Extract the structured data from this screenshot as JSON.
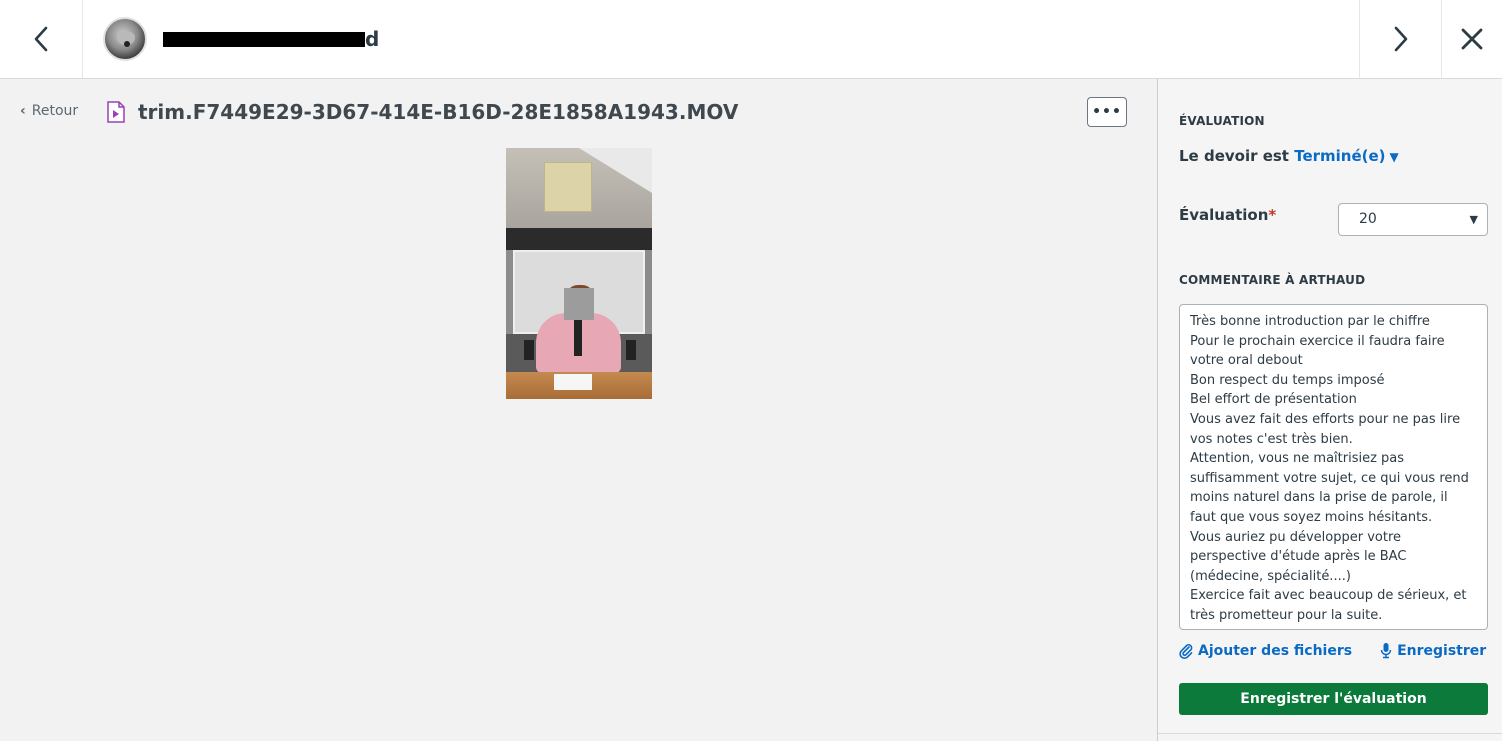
{
  "header": {
    "student_name_tail": "d"
  },
  "main": {
    "back_label": "Retour",
    "file_name": "trim.F7449E29-3D67-414E-B16D-28E1858A1943.MOV",
    "more_label": "•••"
  },
  "sidebar": {
    "section_evaluation": "ÉVALUATION",
    "status_prefix": "Le devoir est ",
    "status_value": "Terminé(e)",
    "grade_label": "Évaluation",
    "grade_required": "*",
    "grade_value": "20",
    "comment_section": "COMMENTAIRE À ARTHAUD",
    "comment_text": "Très bonne introduction par le chiffre\nPour le prochain exercice il faudra faire votre oral debout\nBon respect du temps imposé\nBel effort de présentation\nVous avez fait des efforts pour ne pas lire vos notes c'est très bien.\nAttention, vous ne maîtrisiez pas suffisamment votre sujet, ce qui vous rend moins naturel dans la prise de parole, il faut que vous soyez moins hésitants.\nVous auriez pu développer votre perspective d'étude après le BAC (médecine, spécialité....)\nExercice fait avec beaucoup de sérieux, et très prometteur pour la suite.",
    "attach_label": "Ajouter des fichiers",
    "record_label": "Enregistrer",
    "save_label": "Enregistrer l'évaluation"
  },
  "colors": {
    "link": "#0b6ac4",
    "save_button": "#0b7a3b",
    "required": "#c0392b"
  }
}
